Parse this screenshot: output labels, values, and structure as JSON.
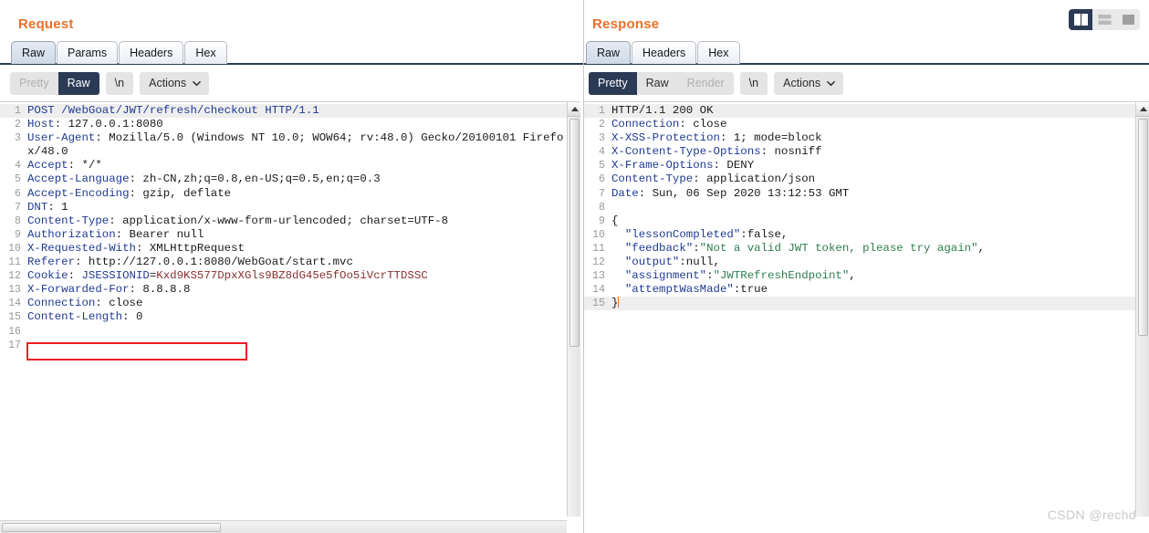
{
  "window": {
    "watermark": "CSDN @rechd"
  },
  "layout_toggle": {
    "buttons": [
      {
        "name": "split-vertical",
        "label": "Split vertical",
        "active": true
      },
      {
        "name": "split-horizontal",
        "label": "Split horizontal",
        "active": false
      },
      {
        "name": "single-pane",
        "label": "Single pane",
        "active": false
      }
    ]
  },
  "request": {
    "title": "Request",
    "tabs": [
      {
        "label": "Raw",
        "active": true
      },
      {
        "label": "Params",
        "active": false
      },
      {
        "label": "Headers",
        "active": false
      },
      {
        "label": "Hex",
        "active": false
      }
    ],
    "toolbar": {
      "pretty": "Pretty",
      "raw": "Raw",
      "newline": "\\n",
      "actions": "Actions",
      "active_view": "Raw",
      "pretty_disabled": true
    },
    "lines": [
      {
        "n": "1",
        "highlight": true,
        "parts": [
          {
            "t": "POST /WebGoat/JWT/refresh/checkout HTTP/1.1",
            "c": "hdr"
          }
        ]
      },
      {
        "n": "2",
        "parts": [
          {
            "t": "Host",
            "c": "hdr"
          },
          {
            "t": ": 127.0.0.1:8080",
            "c": "val"
          }
        ]
      },
      {
        "n": "3",
        "parts": [
          {
            "t": "User-Agent",
            "c": "hdr"
          },
          {
            "t": ": Mozilla/5.0 (Windows NT 10.0; WOW64; rv:48.0) Gecko/20100101 Firefox/48.0",
            "c": "val"
          }
        ]
      },
      {
        "n": "4",
        "parts": [
          {
            "t": "Accept",
            "c": "hdr"
          },
          {
            "t": ": */*",
            "c": "val"
          }
        ]
      },
      {
        "n": "5",
        "parts": [
          {
            "t": "Accept-Language",
            "c": "hdr"
          },
          {
            "t": ": zh-CN,zh;q=0.8,en-US;q=0.5,en;q=0.3",
            "c": "val"
          }
        ]
      },
      {
        "n": "6",
        "parts": [
          {
            "t": "Accept-Encoding",
            "c": "hdr"
          },
          {
            "t": ": gzip, deflate",
            "c": "val"
          }
        ]
      },
      {
        "n": "7",
        "parts": [
          {
            "t": "DNT",
            "c": "hdr"
          },
          {
            "t": ": 1",
            "c": "val"
          }
        ]
      },
      {
        "n": "8",
        "parts": [
          {
            "t": "Content-Type",
            "c": "hdr"
          },
          {
            "t": ": application/x-www-form-urlencoded; charset=UTF-8",
            "c": "val"
          }
        ]
      },
      {
        "n": "9",
        "parts": [
          {
            "t": "Authorization",
            "c": "hdr"
          },
          {
            "t": ": Bearer null",
            "c": "val"
          }
        ]
      },
      {
        "n": "10",
        "parts": [
          {
            "t": "X-Requested-With",
            "c": "hdr"
          },
          {
            "t": ": XMLHttpRequest",
            "c": "val"
          }
        ]
      },
      {
        "n": "11",
        "parts": [
          {
            "t": "Referer",
            "c": "hdr"
          },
          {
            "t": ": http://127.0.0.1:8080/WebGoat/start.mvc",
            "c": "val"
          }
        ]
      },
      {
        "n": "12",
        "parts": [
          {
            "t": "Cookie",
            "c": "hdr"
          },
          {
            "t": ": ",
            "c": "val"
          },
          {
            "t": "JSESSIONID",
            "c": "hdr"
          },
          {
            "t": "=",
            "c": "val"
          },
          {
            "t": "Kxd9KS577DpxXGls9BZ8dG45e5fOo5iVcrTTDSSC",
            "c": "ck"
          }
        ]
      },
      {
        "n": "13",
        "parts": [
          {
            "t": "X-Forwarded-For",
            "c": "hdr"
          },
          {
            "t": ": 8.8.8.8",
            "c": "val"
          }
        ]
      },
      {
        "n": "14",
        "parts": [
          {
            "t": "Connection",
            "c": "hdr"
          },
          {
            "t": ": close",
            "c": "val"
          }
        ]
      },
      {
        "n": "15",
        "parts": [
          {
            "t": "Content-Length",
            "c": "hdr"
          },
          {
            "t": ": 0",
            "c": "val"
          }
        ]
      },
      {
        "n": "16",
        "parts": [
          {
            "t": "",
            "c": "val"
          }
        ]
      },
      {
        "n": "17",
        "parts": [
          {
            "t": "",
            "c": "val"
          }
        ]
      }
    ],
    "annotation": {
      "label": "authorization-header-highlight",
      "color": "#ee1c25"
    }
  },
  "response": {
    "title": "Response",
    "tabs": [
      {
        "label": "Raw",
        "active": true
      },
      {
        "label": "Headers",
        "active": false
      },
      {
        "label": "Hex",
        "active": false
      }
    ],
    "toolbar": {
      "pretty": "Pretty",
      "raw": "Raw",
      "render": "Render",
      "newline": "\\n",
      "actions": "Actions",
      "active_view": "Pretty",
      "render_disabled": true
    },
    "lines": [
      {
        "n": "1",
        "highlight": true,
        "parts": [
          {
            "t": "HTTP/1.1 200 OK",
            "c": "val"
          }
        ]
      },
      {
        "n": "2",
        "parts": [
          {
            "t": "Connection",
            "c": "hdr"
          },
          {
            "t": ": close",
            "c": "val"
          }
        ]
      },
      {
        "n": "3",
        "parts": [
          {
            "t": "X-XSS-Protection",
            "c": "hdr"
          },
          {
            "t": ": 1; mode=block",
            "c": "val"
          }
        ]
      },
      {
        "n": "4",
        "parts": [
          {
            "t": "X-Content-Type-Options",
            "c": "hdr"
          },
          {
            "t": ": nosniff",
            "c": "val"
          }
        ]
      },
      {
        "n": "5",
        "parts": [
          {
            "t": "X-Frame-Options",
            "c": "hdr"
          },
          {
            "t": ": DENY",
            "c": "val"
          }
        ]
      },
      {
        "n": "6",
        "parts": [
          {
            "t": "Content-Type",
            "c": "hdr"
          },
          {
            "t": ": application/json",
            "c": "val"
          }
        ]
      },
      {
        "n": "7",
        "parts": [
          {
            "t": "Date",
            "c": "hdr"
          },
          {
            "t": ": Sun, 06 Sep 2020 13:12:53 GMT",
            "c": "val"
          }
        ]
      },
      {
        "n": "8",
        "parts": [
          {
            "t": "",
            "c": "val"
          }
        ]
      },
      {
        "n": "9",
        "parts": [
          {
            "t": "{",
            "c": "punc"
          }
        ]
      },
      {
        "n": "10",
        "parts": [
          {
            "t": "  \"lessonCompleted\"",
            "c": "hdr"
          },
          {
            "t": ":false,",
            "c": "val"
          }
        ]
      },
      {
        "n": "11",
        "parts": [
          {
            "t": "  \"feedback\"",
            "c": "hdr"
          },
          {
            "t": ":",
            "c": "val"
          },
          {
            "t": "\"Not a valid JWT token, please try again\"",
            "c": "str"
          },
          {
            "t": ",",
            "c": "val"
          }
        ]
      },
      {
        "n": "12",
        "parts": [
          {
            "t": "  \"output\"",
            "c": "hdr"
          },
          {
            "t": ":null,",
            "c": "val"
          }
        ]
      },
      {
        "n": "13",
        "parts": [
          {
            "t": "  \"assignment\"",
            "c": "hdr"
          },
          {
            "t": ":",
            "c": "val"
          },
          {
            "t": "\"JWTRefreshEndpoint\"",
            "c": "str"
          },
          {
            "t": ",",
            "c": "val"
          }
        ]
      },
      {
        "n": "14",
        "parts": [
          {
            "t": "  \"attemptWasMade\"",
            "c": "hdr"
          },
          {
            "t": ":true",
            "c": "val"
          }
        ]
      },
      {
        "n": "15",
        "highlight": true,
        "cursor": true,
        "parts": [
          {
            "t": "}",
            "c": "punc"
          }
        ]
      }
    ]
  }
}
